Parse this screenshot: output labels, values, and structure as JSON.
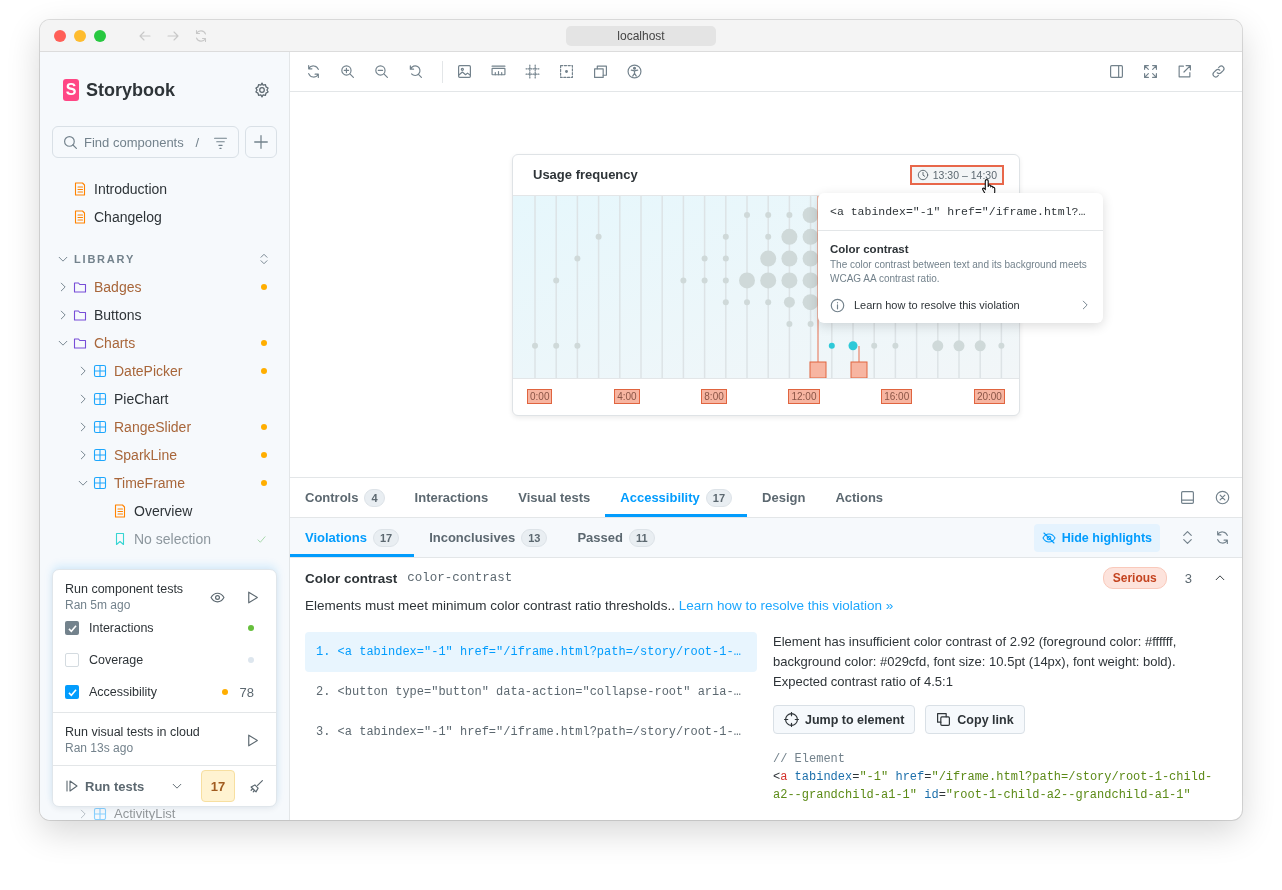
{
  "browser": {
    "url": "localhost"
  },
  "sidebar": {
    "brand": "Storybook",
    "logo_letter": "S",
    "search": {
      "placeholder": "Find components",
      "shortcut": "/"
    },
    "docs": [
      {
        "kind": "docs",
        "label": "Introduction"
      },
      {
        "kind": "docs",
        "label": "Changelog"
      }
    ],
    "section": {
      "label": "LIBRARY",
      "expanded": true
    },
    "tree": [
      {
        "kind": "folder",
        "label": "Badges",
        "expanded": false,
        "has_issues": true
      },
      {
        "kind": "folder",
        "label": "Buttons",
        "expanded": false,
        "has_issues": false
      },
      {
        "kind": "folder",
        "label": "Charts",
        "expanded": true,
        "has_issues": true,
        "children": [
          {
            "kind": "component",
            "label": "DatePicker",
            "expanded": false,
            "has_issues": true
          },
          {
            "kind": "component",
            "label": "PieChart",
            "expanded": false,
            "has_issues": false
          },
          {
            "kind": "component",
            "label": "RangeSlider",
            "expanded": false,
            "has_issues": true
          },
          {
            "kind": "component",
            "label": "SparkLine",
            "expanded": false,
            "has_issues": true
          },
          {
            "kind": "component",
            "label": "TimeFrame",
            "expanded": true,
            "has_issues": true,
            "children": [
              {
                "kind": "docs",
                "label": "Overview",
                "has_issues": false
              },
              {
                "kind": "story",
                "label": "No selection",
                "has_issues": false,
                "passed": true
              }
            ]
          }
        ]
      }
    ],
    "peeking_item": {
      "kind": "component",
      "label": "ActivityList"
    },
    "testing": {
      "component_tests": {
        "title": "Run component tests",
        "subtitle": "Ran 5m ago",
        "options": [
          {
            "label": "Interactions",
            "checked": true,
            "disabled": true,
            "color": "#66bf3c"
          },
          {
            "label": "Coverage",
            "checked": false,
            "disabled": false,
            "color": "#dde6ee"
          },
          {
            "label": "Accessibility",
            "checked": true,
            "disabled": false,
            "color": "#ffae00",
            "count": "78"
          }
        ]
      },
      "visual_tests": {
        "title": "Run visual tests in cloud",
        "subtitle": "Ran 13s ago"
      },
      "run_label": "Run tests",
      "count": "17"
    }
  },
  "preview": {
    "violation_highlights": true,
    "card": {
      "title": "Usage frequency",
      "range": "13:30 – 14:30",
      "axis_labels": [
        "0:00",
        "4:00",
        "8:00",
        "12:00",
        "16:00",
        "20:00"
      ]
    },
    "popover": {
      "code": "<a tabindex=\"-1\" href=\"/iframe.html?…",
      "title": "Color contrast",
      "description": "The color contrast between text and its background meets WCAG AA contrast ratio.",
      "link": "Learn how to resolve this violation"
    }
  },
  "addon_panel": {
    "tabs": [
      {
        "label": "Controls",
        "count": "4",
        "selected": false
      },
      {
        "label": "Interactions",
        "selected": false
      },
      {
        "label": "Visual tests",
        "selected": false
      },
      {
        "label": "Accessibility",
        "count": "17",
        "selected": true
      },
      {
        "label": "Design",
        "selected": false
      },
      {
        "label": "Actions",
        "selected": false
      }
    ],
    "subtabs": [
      {
        "label": "Violations",
        "count": "17",
        "selected": true
      },
      {
        "label": "Inconclusives",
        "count": "13",
        "selected": false
      },
      {
        "label": "Passed",
        "count": "11",
        "selected": false
      }
    ],
    "highlight_toggle": "Hide highlights",
    "rule": {
      "title": "Color contrast",
      "id": "color-contrast",
      "severity": "Serious",
      "count": "3",
      "expanded": true,
      "description": "Elements must meet minimum color contrast ratio thresholds..",
      "link": "Learn how to resolve this violation »"
    },
    "nodes": [
      {
        "number": "1.",
        "code": "<a tabindex=\"-1\" href=\"/iframe.html?path=/story/root-1-…",
        "selected": true
      },
      {
        "number": "2.",
        "code": "<button type=\"button\" data-action=\"collapse-root\" aria-…",
        "selected": false
      },
      {
        "number": "3.",
        "code": "<a tabindex=\"-1\" href=\"/iframe.html?path=/story/root-1-…",
        "selected": false
      }
    ],
    "detail": {
      "message": "Element has insufficient color contrast of 2.92 (foreground color: #ffffff, background color: #029cfd, font size: 10.5pt (14px), font weight: bold). Expected contrast ratio of 4.5:1",
      "buttons": [
        {
          "kind": "jump",
          "label": "Jump to element"
        },
        {
          "kind": "copy",
          "label": "Copy link"
        }
      ],
      "code_comment": "// Element",
      "code_lines": [
        [
          {
            "kind": "punct",
            "text": "<"
          },
          {
            "kind": "tag",
            "text": "a"
          },
          {
            "kind": "attr",
            "text": " tabindex"
          },
          {
            "kind": "punct",
            "text": "="
          },
          {
            "kind": "value",
            "text": "\"-1\""
          },
          {
            "kind": "attr",
            "text": " href"
          },
          {
            "kind": "punct",
            "text": "="
          },
          {
            "kind": "value",
            "text": "\"/iframe.html?path=/story/root-1-child-"
          }
        ],
        [
          {
            "kind": "value",
            "text": "a2--grandchild-a1-1\""
          },
          {
            "kind": "attr",
            "text": " id"
          },
          {
            "kind": "punct",
            "text": "="
          },
          {
            "kind": "value",
            "text": "\"root-1-child-a2--grandchild-a1-1\""
          }
        ]
      ]
    }
  }
}
